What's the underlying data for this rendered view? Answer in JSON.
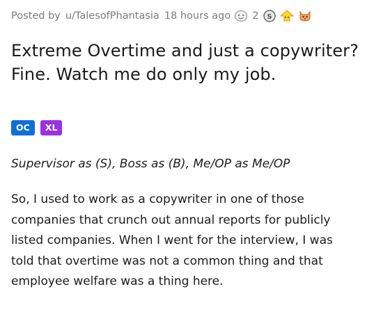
{
  "meta": {
    "posted_by": "Posted by",
    "username": "u/TalesofPhantasia",
    "time": "18 hours ago",
    "award_count": "2",
    "icons": [
      "helpful-award-icon",
      "silver-award-icon",
      "upvote-award-icon",
      "cat-award-icon"
    ]
  },
  "post": {
    "title": "Extreme Overtime and just a copywriter? Fine. Watch me do only my job.",
    "flairs": [
      "OC",
      "XL"
    ],
    "flair_colors": {
      "OC": "#0f6fd7",
      "XL": "#9932e0"
    },
    "subtitle": "Supervisor as (S), Boss as (B), Me/OP as Me/OP",
    "body": "So, I used to work as a copywriter in one of those companies that crunch out annual reports for publicly listed companies. When I went for the interview, I was told that overtime was not a common thing and that employee welfare was a thing here."
  }
}
